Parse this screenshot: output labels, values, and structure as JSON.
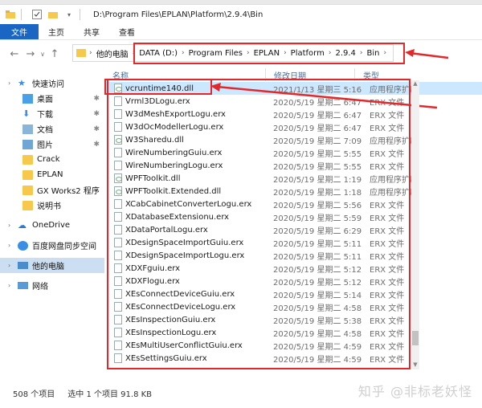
{
  "window": {
    "path_title": "D:\\Program Files\\EPLAN\\Platform\\2.9.4\\Bin"
  },
  "ribbon": {
    "tabs": [
      "文件",
      "主页",
      "共享",
      "查看"
    ]
  },
  "address": {
    "crumbs": [
      "他的电脑",
      "DATA (D:)",
      "Program Files",
      "EPLAN",
      "Platform",
      "2.9.4",
      "Bin"
    ]
  },
  "sidebar": {
    "items": [
      {
        "label": "快速访问",
        "icon": "star-icon"
      },
      {
        "label": "桌面",
        "icon": "desktop-folder-icon",
        "pinned": true
      },
      {
        "label": "下载",
        "icon": "download-folder-icon",
        "pinned": true
      },
      {
        "label": "文档",
        "icon": "documents-folder-icon",
        "pinned": true
      },
      {
        "label": "图片",
        "icon": "pictures-folder-icon",
        "pinned": true
      },
      {
        "label": "Crack",
        "icon": "folder-icon"
      },
      {
        "label": "EPLAN",
        "icon": "folder-icon"
      },
      {
        "label": "GX Works2 程序",
        "icon": "folder-icon"
      },
      {
        "label": "说明书",
        "icon": "folder-icon"
      },
      {
        "label": "OneDrive",
        "icon": "cloud-icon"
      },
      {
        "label": "百度网盘同步空间",
        "icon": "baidu-disk-icon"
      },
      {
        "label": "他的电脑",
        "icon": "computer-icon"
      },
      {
        "label": "网络",
        "icon": "network-icon"
      }
    ]
  },
  "columns": {
    "name": "名称",
    "date": "修改日期",
    "type": "类型"
  },
  "files": [
    {
      "name": "vcruntime140.dll",
      "date": "2021/1/13 星期三 5:16",
      "type": "应用程序扩展",
      "ext": "dll"
    },
    {
      "name": "Vrml3DLogu.erx",
      "date": "2020/5/19 星期二 6:47",
      "type": "ERX 文件",
      "ext": "erx"
    },
    {
      "name": "W3dMeshExportLogu.erx",
      "date": "2020/5/19 星期二 6:47",
      "type": "ERX 文件",
      "ext": "erx"
    },
    {
      "name": "W3dOcModellerLogu.erx",
      "date": "2020/5/19 星期二 6:47",
      "type": "ERX 文件",
      "ext": "erx"
    },
    {
      "name": "W3Sharedu.dll",
      "date": "2020/5/19 星期二 7:09",
      "type": "应用程序扩展",
      "ext": "dll"
    },
    {
      "name": "WireNumberingGuiu.erx",
      "date": "2020/5/19 星期二 5:55",
      "type": "ERX 文件",
      "ext": "erx"
    },
    {
      "name": "WireNumberingLogu.erx",
      "date": "2020/5/19 星期二 5:55",
      "type": "ERX 文件",
      "ext": "erx"
    },
    {
      "name": "WPFToolkit.dll",
      "date": "2020/5/19 星期二 1:19",
      "type": "应用程序扩展",
      "ext": "dll"
    },
    {
      "name": "WPFToolkit.Extended.dll",
      "date": "2020/5/19 星期二 1:18",
      "type": "应用程序扩展",
      "ext": "dll"
    },
    {
      "name": "XCabCabinetConverterLogu.erx",
      "date": "2020/5/19 星期二 5:56",
      "type": "ERX 文件",
      "ext": "erx"
    },
    {
      "name": "XDatabaseExtensionu.erx",
      "date": "2020/5/19 星期二 5:59",
      "type": "ERX 文件",
      "ext": "erx"
    },
    {
      "name": "XDataPortalLogu.erx",
      "date": "2020/5/19 星期二 6:29",
      "type": "ERX 文件",
      "ext": "erx"
    },
    {
      "name": "XDesignSpaceImportGuiu.erx",
      "date": "2020/5/19 星期二 5:11",
      "type": "ERX 文件",
      "ext": "erx"
    },
    {
      "name": "XDesignSpaceImportLogu.erx",
      "date": "2020/5/19 星期二 5:11",
      "type": "ERX 文件",
      "ext": "erx"
    },
    {
      "name": "XDXFguiu.erx",
      "date": "2020/5/19 星期二 5:12",
      "type": "ERX 文件",
      "ext": "erx"
    },
    {
      "name": "XDXFlogu.erx",
      "date": "2020/5/19 星期二 5:12",
      "type": "ERX 文件",
      "ext": "erx"
    },
    {
      "name": "XEsConnectDeviceGuiu.erx",
      "date": "2020/5/19 星期二 5:14",
      "type": "ERX 文件",
      "ext": "erx"
    },
    {
      "name": "XEsConnectDeviceLogu.erx",
      "date": "2020/5/19 星期二 4:58",
      "type": "ERX 文件",
      "ext": "erx"
    },
    {
      "name": "XEsInspectionGuiu.erx",
      "date": "2020/5/19 星期二 5:38",
      "type": "ERX 文件",
      "ext": "erx"
    },
    {
      "name": "XEsInspectionLogu.erx",
      "date": "2020/5/19 星期二 4:58",
      "type": "ERX 文件",
      "ext": "erx"
    },
    {
      "name": "XEsMultiUserConflictGuiu.erx",
      "date": "2020/5/19 星期二 4:59",
      "type": "ERX 文件",
      "ext": "erx"
    },
    {
      "name": "XEsSettingsGuiu.erx",
      "date": "2020/5/19 星期二 4:59",
      "type": "ERX 文件",
      "ext": "erx"
    }
  ],
  "status": {
    "count": "508 个项目",
    "selected": "选中 1 个项目  91.8 KB"
  },
  "watermark": "知乎 @非标老妖怪",
  "colors": {
    "accent": "#1a66c2",
    "highlight": "#e3282b",
    "selection": "#cce8ff"
  }
}
